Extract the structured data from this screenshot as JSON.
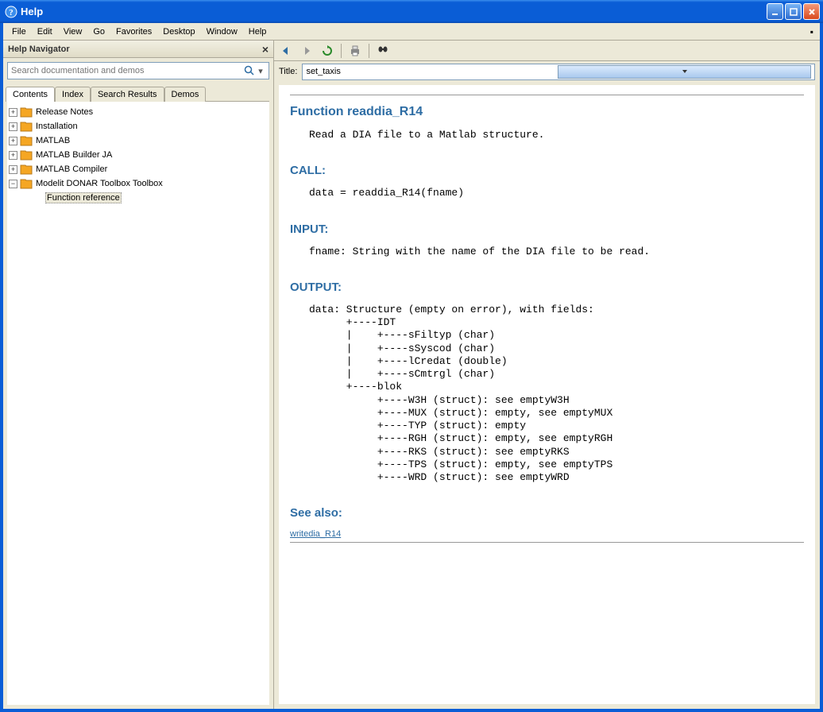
{
  "window": {
    "title": "Help"
  },
  "menu": {
    "items": [
      "File",
      "Edit",
      "View",
      "Go",
      "Favorites",
      "Desktop",
      "Window",
      "Help"
    ]
  },
  "navigator": {
    "title": "Help Navigator",
    "searchPlaceholder": "Search documentation and demos",
    "tabs": [
      "Contents",
      "Index",
      "Search Results",
      "Demos"
    ],
    "activeTab": 0,
    "tree": [
      {
        "label": "Release Notes",
        "expanded": false,
        "depth": 0
      },
      {
        "label": "Installation",
        "expanded": false,
        "depth": 0
      },
      {
        "label": "MATLAB",
        "expanded": false,
        "depth": 0
      },
      {
        "label": "MATLAB Builder JA",
        "expanded": false,
        "depth": 0
      },
      {
        "label": "MATLAB Compiler",
        "expanded": false,
        "depth": 0
      },
      {
        "label": "Modelit DONAR Toolbox Toolbox",
        "expanded": true,
        "depth": 0
      },
      {
        "label": "Function reference",
        "expanded": null,
        "depth": 1,
        "selected": true
      }
    ]
  },
  "titlefield": {
    "label": "Title:",
    "value": "set_taxis"
  },
  "doc": {
    "h_func": "Function readdia_R14",
    "desc": "Read a DIA file to a Matlab structure.",
    "h_call": "CALL:",
    "call": "data = readdia_R14(fname)",
    "h_input": "INPUT:",
    "input": "fname: String with the name of the DIA file to be read.",
    "h_output": "OUTPUT:",
    "output": "data: Structure (empty on error), with fields:\n      +----IDT\n      |    +----sFiltyp (char)\n      |    +----sSyscod (char)\n      |    +----lCredat (double)\n      |    +----sCmtrgl (char)\n      +----blok\n           +----W3H (struct): see emptyW3H\n           +----MUX (struct): empty, see emptyMUX\n           +----TYP (struct): empty\n           +----RGH (struct): empty, see emptyRGH\n           +----RKS (struct): see emptyRKS\n           +----TPS (struct): empty, see emptyTPS\n           +----WRD (struct): see emptyWRD",
    "h_seealso": "See also:",
    "seealso_link": "writedia_R14"
  }
}
